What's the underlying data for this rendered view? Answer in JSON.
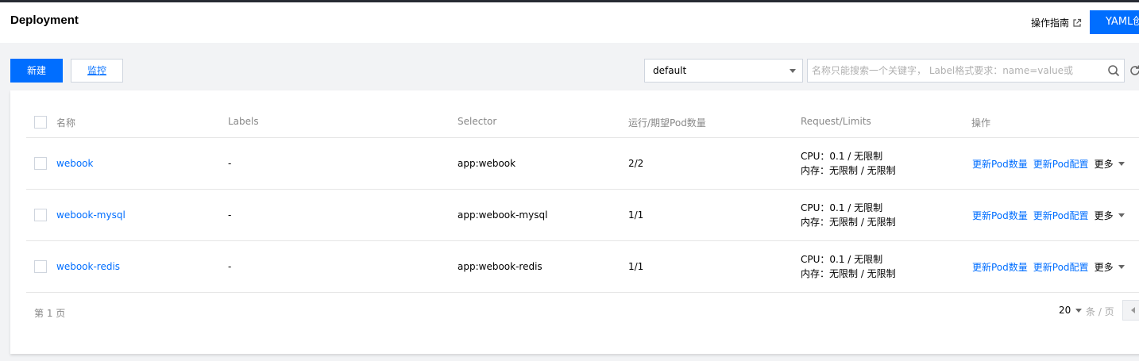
{
  "header": {
    "title": "Deployment",
    "guide_label": "操作指南",
    "yaml_button_label": "YAML创建"
  },
  "toolbar": {
    "new_label": "新建",
    "monitor_label": "监控",
    "namespace_value": "default",
    "search_placeholder": "名称只能搜索一个关键字， Label格式要求：name=value或"
  },
  "table": {
    "columns": [
      "名称",
      "Labels",
      "Selector",
      "运行/期望Pod数量",
      "Request/Limits",
      "操作"
    ],
    "rows": [
      {
        "name": "webook",
        "labels": "-",
        "selector": "app:webook",
        "pods": "2/2",
        "request": "CPU：0.1 / 无限制",
        "memory": "内存：无限制 / 无限制",
        "op_scale": "更新Pod数量",
        "op_config": "更新Pod配置",
        "op_more": "更多"
      },
      {
        "name": "webook-mysql",
        "labels": "-",
        "selector": "app:webook-mysql",
        "pods": "1/1",
        "request": "CPU：0.1 / 无限制",
        "memory": "内存：无限制 / 无限制",
        "op_scale": "更新Pod数量",
        "op_config": "更新Pod配置",
        "op_more": "更多"
      },
      {
        "name": "webook-redis",
        "labels": "-",
        "selector": "app:webook-redis",
        "pods": "1/1",
        "request": "CPU：0.1 / 无限制",
        "memory": "内存：无限制 / 无限制",
        "op_scale": "更新Pod数量",
        "op_config": "更新Pod配置",
        "op_more": "更多"
      }
    ]
  },
  "pagination": {
    "current_page": "第 1 页",
    "page_size": "20",
    "page_size_unit": "条 / 页"
  },
  "colors": {
    "accent": "#006eff",
    "top_strip": "#272b33",
    "background": "#f2f3f5"
  },
  "icons": {
    "guide": "external-link-icon",
    "search": "search-icon",
    "refresh": "refresh-icon"
  }
}
